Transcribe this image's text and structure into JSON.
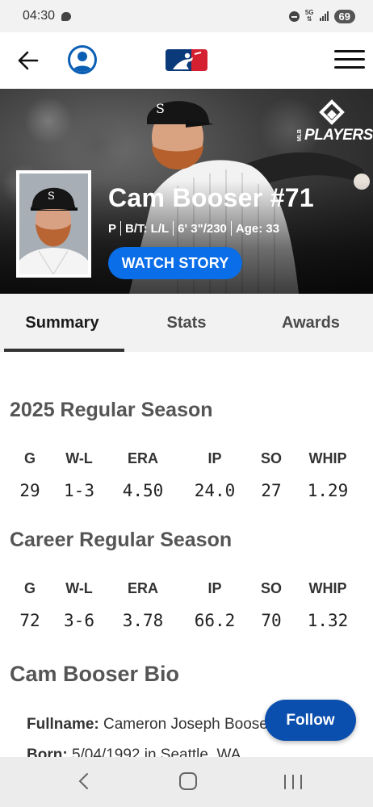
{
  "status_bar": {
    "time": "04:30",
    "network": "5G",
    "battery": "69"
  },
  "header": {
    "back_icon": "arrow-left-icon",
    "profile_icon": "user-circle-icon",
    "logo": "mlb-logo",
    "menu_icon": "hamburger-menu-icon"
  },
  "hero": {
    "brand": "PLAYERS",
    "brand_small": "MLB",
    "name": "Cam Booser #71",
    "position": "P",
    "bats_throws": "B/T: L/L",
    "height_weight": "6' 3\"/230",
    "age": "Age: 33",
    "watch_label": "WATCH STORY"
  },
  "tabs": [
    {
      "label": "Summary",
      "active": true
    },
    {
      "label": "Stats",
      "active": false
    },
    {
      "label": "Awards",
      "active": false
    }
  ],
  "season": {
    "title": "2025 Regular Season",
    "headers": [
      "G",
      "W-L",
      "ERA",
      "IP",
      "SO",
      "WHIP"
    ],
    "values": [
      "29",
      "1-3",
      "4.50",
      "24.0",
      "27",
      "1.29"
    ]
  },
  "career": {
    "title": "Career Regular Season",
    "headers": [
      "G",
      "W-L",
      "ERA",
      "IP",
      "SO",
      "WHIP"
    ],
    "values": [
      "72",
      "3-6",
      "3.78",
      "66.2",
      "70",
      "1.32"
    ]
  },
  "bio": {
    "title": "Cam Booser Bio",
    "fullname_label": "Fullname:",
    "fullname_value": "Cameron Joseph Booser",
    "born_label": "Born:",
    "born_value": "5/04/1992 in Seattle, WA"
  },
  "follow_label": "Follow",
  "colors": {
    "accent": "#0a6ee8",
    "follow": "#0a4fae",
    "mlb_blue": "#0a3a7a",
    "mlb_red": "#d42030"
  }
}
